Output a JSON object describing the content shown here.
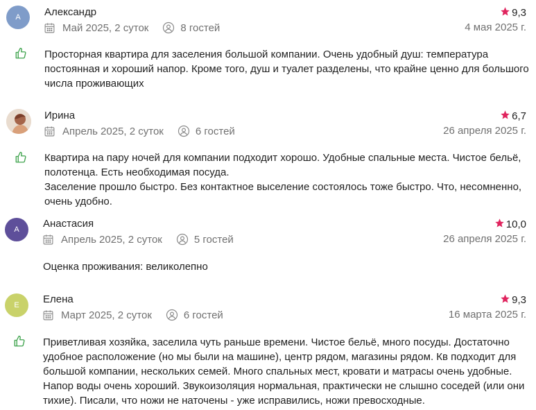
{
  "reviews": [
    {
      "name": "Александр",
      "avatar_letter": "А",
      "avatar_color": "#7f9cc9",
      "rating": "9,3",
      "stay": "Май 2025, 2 суток",
      "guests": "8 гостей",
      "date": "4 мая 2025 г.",
      "text": "Просторная квартира для заселения большой компании. Очень удобный душ: температура\nпостоянная и хороший напор. Кроме того, душ и туалет разделены, что крайне ценно для большого\nчисла проживающих"
    },
    {
      "name": "Ирина",
      "avatar_letter": "",
      "avatar_color": "#e9d7c8",
      "rating": "6,7",
      "stay": "Апрель 2025, 2 суток",
      "guests": "6 гостей",
      "date": "26 апреля 2025 г.",
      "text": "Квартира на пару ночей для компании подходит хорошо. Удобные спальные места. Чистое бельё,\nполотенца. Есть необходимая посуда.\nЗаселение прошло быстро. Без контактное выселение состоялось тоже быстро. Что, несомненно,\nочень удобно."
    },
    {
      "name": "Анастасия",
      "avatar_letter": "А",
      "avatar_color": "#5e4f9a",
      "rating": "10,0",
      "stay": "Апрель 2025, 2 суток",
      "guests": "5 гостей",
      "date": "26 апреля 2025 г.",
      "text": "Оценка проживания: великолепно"
    },
    {
      "name": "Елена",
      "avatar_letter": "Е",
      "avatar_color": "#c9d26a",
      "rating": "9,3",
      "stay": "Март 2025, 2 суток",
      "guests": "6 гостей",
      "date": "16 марта 2025 г.",
      "text": "Приветливая хозяйка, заселила чуть раньше времени. Чистое бельё, много посуды. Достаточно\nудобное расположение (но мы были на машине), центр рядом, магазины рядом. Кв подходит для\nбольшой компании, нескольких семей. Много спальных мест, кровати и матрасы очень удобные.\nНапор воды очень хороший. Звукоизоляция нормальная, практически не слышно соседей (или они\nтихие). Писали, что ножи не наточены - уже исправились, ножи превосходные."
    }
  ],
  "colors": {
    "star": "#e0245e",
    "thumb": "#3fa34d",
    "muted": "#707070"
  },
  "icons": {
    "star": "star-icon",
    "calendar": "calendar-icon",
    "person": "person-icon",
    "thumb": "thumbs-up-icon"
  }
}
